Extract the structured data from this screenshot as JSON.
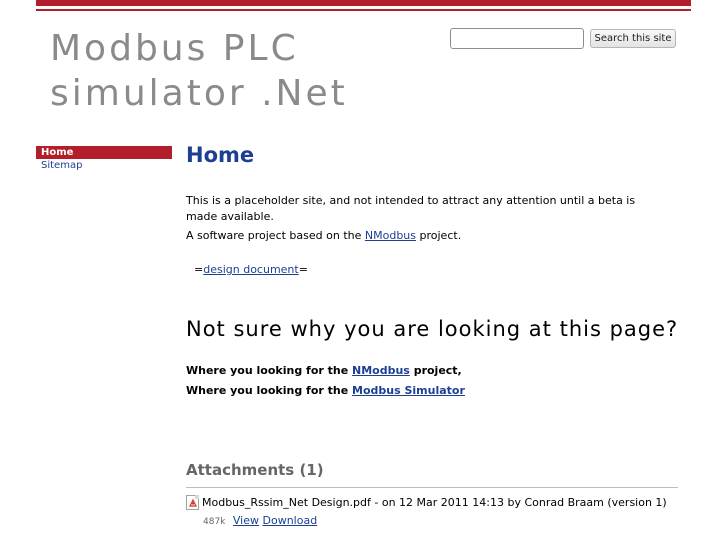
{
  "site": {
    "title_line1": "Modbus PLC",
    "title_line2": "simulator .Net"
  },
  "search": {
    "value": "",
    "button_label": "Search this site"
  },
  "nav": {
    "items": [
      {
        "label": "Home",
        "active": true
      },
      {
        "label": "Sitemap",
        "active": false
      }
    ]
  },
  "page": {
    "title": "Home",
    "para1": "This is a placeholder site, and not intended to attract any attention until a beta is made available.",
    "para2_prefix": "A software project based on the ",
    "para2_link": "NModbus",
    "para2_suffix": " project.",
    "para3_prefix": "=",
    "para3_link": "design document",
    "para3_suffix": "=",
    "heading2": "Not sure why you are looking at this page?",
    "line1_prefix": "Where you looking for the ",
    "line1_link": "NModbus",
    "line1_suffix": " project,",
    "line2_prefix": "Where you looking for the ",
    "line2_link": "Modbus Simulator"
  },
  "attachments": {
    "title": "Attachments (1)",
    "items": [
      {
        "icon": "pdf-file-icon",
        "filename": "Modbus_Rssim_Net Design.pdf",
        "info": " - on 12 Mar 2011 14:13 by Conrad Braam (version 1)",
        "size": "487k",
        "view_label": "View",
        "download_label": "Download"
      }
    ]
  },
  "colors": {
    "accent": "#b21e2a",
    "link": "#1c3f94",
    "title_gray": "#8a8a8a"
  }
}
